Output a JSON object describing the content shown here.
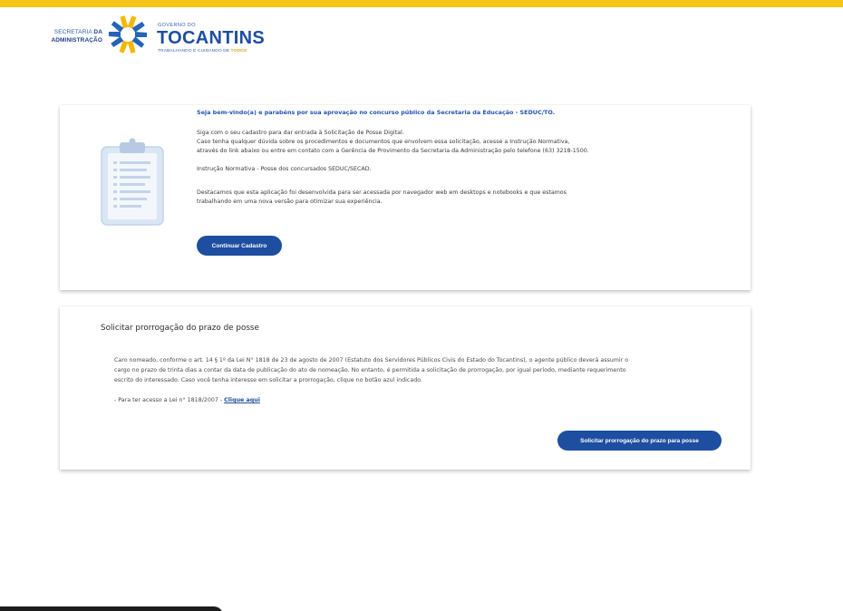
{
  "header": {
    "secretaria_line1_prefix": "SECRETARIA",
    "secretaria_line1_bold": "DA",
    "secretaria_line2": "ADMINISTRAÇÃO",
    "gov_small": "GOVERNO DO",
    "gov_big": "TOCANTINS",
    "gov_tag_prefix": "TRABALHANDO E CUIDANDO DE",
    "gov_tag_bold": "TODOS",
    "topbar_color": "#f5c518",
    "brand_blue": "#1d4ea0"
  },
  "welcome_card": {
    "icon": "clipboard-icon",
    "welcome": "Seja bem-vindo(a) e parabéns por sua aprovação no concurso público da Secretaria da Educação - SEDUC/TO.",
    "line1": "Siga com o seu cadastro para dar entrada à Solicitação de Posse Digital.",
    "line2": "Caso tenha qualquer dúvida sobre os procedimentos e documentos que envolvem essa solicitação, acesse a Instrução Normativa,",
    "line3": "através do link abaixo ou entre em contato com a Gerência de Provimento da Secretaria da Administração pelo telefone (63) 3218-1500.",
    "instrucao": "Instrução Normativa - Posse dos concursados SEDUC/SECAD.",
    "destaque1": "Destacamos que esta aplicação foi desenvolvida para ser acessada por navegador web em desktops e notebooks e que estamos",
    "destaque2": "trabalhando em uma nova versão para otimizar sua experiência.",
    "button": "Continuar Cadastro"
  },
  "prorrogacao_card": {
    "title": "Solicitar prorrogação do prazo de posse",
    "p1": "Caro nomeado, conforme o art. 14 § 1º da Lei N° 1818 de 23 de agosto de 2007 (Estatuto dos Servidores Públicos Civis do Estado do Tocantins), o agente público deverá assumir o",
    "p2": "cargo no prazo de trinta dias a contar da data de publicação do ato de nomeação. No entanto, é permitida a solicitação de prorrogação, por igual período, mediante requerimento",
    "p3": "escrito do interessado. Caso você tenha interesse em solicitar a prorrogação, clique no botão azul indicado.",
    "lei_prefix": "- Para ter acesso a Lei n° 1818/2007 -",
    "lei_link": "Clique aqui",
    "button": "Solicitar prorrogação do prazo para posse"
  }
}
